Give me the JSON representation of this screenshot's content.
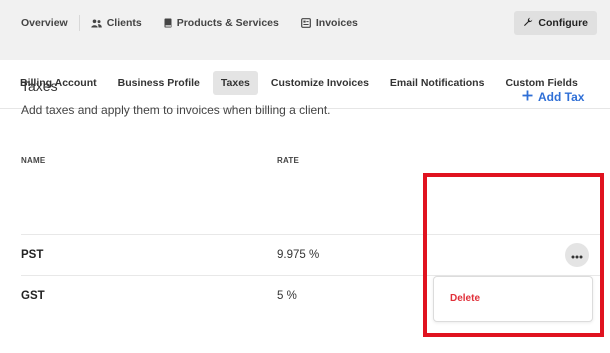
{
  "top_nav": {
    "items": [
      {
        "label": "Overview",
        "icon": "none"
      },
      {
        "label": "Clients",
        "icon": "users-icon"
      },
      {
        "label": "Products & Services",
        "icon": "book-icon"
      },
      {
        "label": "Invoices",
        "icon": "invoice-icon"
      }
    ],
    "configure_label": "Configure"
  },
  "sub_tabs": {
    "items": [
      {
        "label": "Billing Account"
      },
      {
        "label": "Business Profile"
      },
      {
        "label": "Taxes"
      },
      {
        "label": "Customize Invoices"
      },
      {
        "label": "Email Notifications"
      },
      {
        "label": "Custom Fields"
      }
    ],
    "active": "Taxes"
  },
  "taxes": {
    "title": "Taxes",
    "description": "Add taxes and apply them to invoices when billing a client.",
    "add_label": "Add Tax",
    "columns": {
      "name": "NAME",
      "rate": "RATE"
    },
    "rows": [
      {
        "name": "PST",
        "rate": "9.975 %"
      },
      {
        "name": "GST",
        "rate": "5 %"
      }
    ]
  },
  "row_menu": {
    "items": [
      {
        "label": "Delete"
      }
    ]
  },
  "colors": {
    "accent": "#2f6fd6",
    "danger": "#e0303a",
    "highlight": "#e0121f"
  }
}
